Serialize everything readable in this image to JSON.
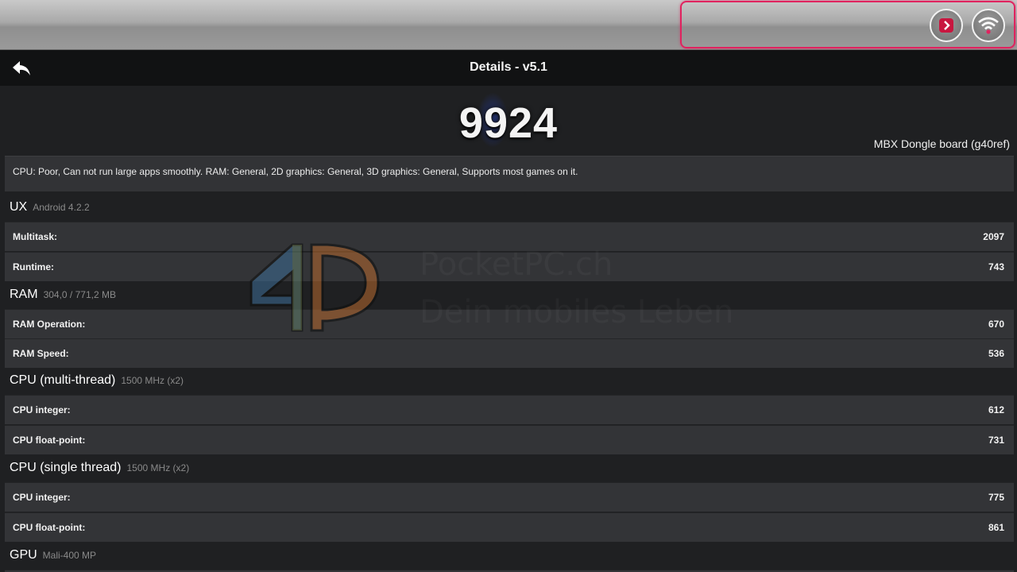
{
  "status_bar": {
    "icons": [
      "app-notification-icon",
      "wifi-icon"
    ],
    "highlight_color": "#e0235f"
  },
  "action_bar": {
    "title": "Details - v5.1",
    "back_icon": "back-arrow-icon"
  },
  "score": {
    "value": "9924",
    "device": "MBX Dongle board (g40ref)"
  },
  "summary": "CPU: Poor, Can not run large apps smoothly. RAM: General, 2D graphics: General, 3D graphics: General, Supports most games on it.",
  "watermark": {
    "line1": "PocketPC.ch",
    "line2": "Dein mobiles Leben"
  },
  "sections": {
    "ux": {
      "title": "UX",
      "sub": "Android 4.2.2",
      "rows": [
        {
          "label": "Multitask:",
          "value": "2097"
        },
        {
          "label": "Runtime:",
          "value": "743"
        }
      ]
    },
    "ram": {
      "title": "RAM",
      "sub": "304,0 / 771,2 MB",
      "rows": [
        {
          "label": "RAM Operation:",
          "value": "670"
        },
        {
          "label": "RAM Speed:",
          "value": "536"
        }
      ]
    },
    "cpu_multi": {
      "title": "CPU (multi-thread)",
      "sub": "1500 MHz (x2)",
      "rows": [
        {
          "label": "CPU integer:",
          "value": "612"
        },
        {
          "label": "CPU float-point:",
          "value": "731"
        }
      ]
    },
    "cpu_single": {
      "title": "CPU (single thread)",
      "sub": "1500 MHz (x2)",
      "rows": [
        {
          "label": "CPU integer:",
          "value": "775"
        },
        {
          "label": "CPU float-point:",
          "value": "861"
        }
      ]
    },
    "gpu": {
      "title": "GPU",
      "sub": "Mali-400 MP"
    }
  }
}
